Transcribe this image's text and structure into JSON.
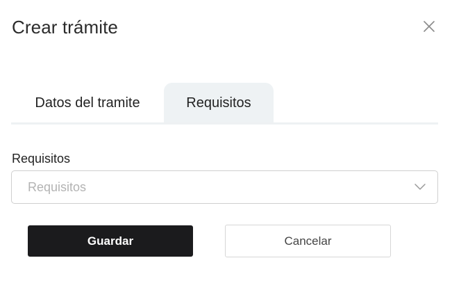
{
  "modal": {
    "title": "Crear trámite"
  },
  "tabs": [
    {
      "label": "Datos del tramite",
      "active": false
    },
    {
      "label": "Requisitos",
      "active": true
    }
  ],
  "form": {
    "requisitos_label": "Requisitos",
    "requisitos_placeholder": "Requisitos",
    "requisitos_value": ""
  },
  "actions": {
    "save_label": "Guardar",
    "cancel_label": "Cancelar"
  },
  "icons": {
    "close": "close-icon",
    "select_arrow": "chevron-down-icon"
  },
  "colors": {
    "primary_button": "#1b1b1d",
    "active_tab_bg": "#eef2f4",
    "placeholder_text": "#b3b3b3"
  }
}
